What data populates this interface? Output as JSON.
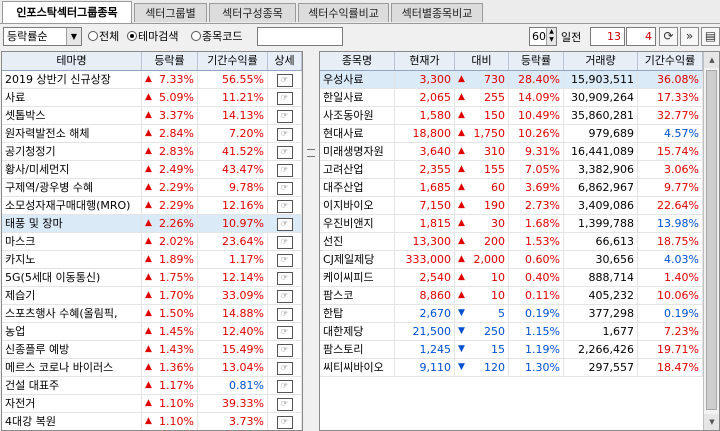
{
  "tabs": [
    "인포스탁섹터그룹종목",
    "섹터그룹별",
    "섹터구성종목",
    "섹터수익률비교",
    "섹터별종목비교"
  ],
  "toolbar": {
    "sort_select": "등락률순",
    "radio_all": "전체",
    "radio_theme": "테마검색",
    "radio_code": "종목코드",
    "code_value": "",
    "days_value": "60",
    "days_label": "일전",
    "num1": "13",
    "num2": "4",
    "icons": [
      "refresh-icon",
      "double-chevron-right-icon",
      "next-page-icon"
    ]
  },
  "colors": {
    "up": "#e00000",
    "down": "#0050d0",
    "highlight": "#dbeaf7",
    "header": "#e8eef6"
  },
  "left_table": {
    "headers": [
      "테마명",
      "등락률",
      "기간수익률",
      "상세"
    ],
    "detail_label": "☞",
    "rows": [
      {
        "name": "2019 상반기 신규상장",
        "change": "7.33%",
        "period": "56.55%",
        "dir": "up"
      },
      {
        "name": "사료",
        "change": "5.09%",
        "period": "11.21%",
        "dir": "up"
      },
      {
        "name": "셋톱박스",
        "change": "3.37%",
        "period": "14.13%",
        "dir": "up"
      },
      {
        "name": "원자력발전소 해체",
        "change": "2.84%",
        "period": "7.20%",
        "dir": "up"
      },
      {
        "name": "공기청정기",
        "change": "2.83%",
        "period": "41.52%",
        "dir": "up"
      },
      {
        "name": "황사/미세먼지",
        "change": "2.49%",
        "period": "43.47%",
        "dir": "up"
      },
      {
        "name": "구제역/광우병 수혜",
        "change": "2.29%",
        "period": "9.78%",
        "dir": "up"
      },
      {
        "name": "소모성자재구매대행(MRO)",
        "change": "2.29%",
        "period": "12.16%",
        "dir": "up"
      },
      {
        "name": "태풍 및 장마",
        "change": "2.26%",
        "period": "10.97%",
        "dir": "up",
        "hl": true
      },
      {
        "name": "마스크",
        "change": "2.02%",
        "period": "23.64%",
        "dir": "up"
      },
      {
        "name": "카지노",
        "change": "1.89%",
        "period": "1.17%",
        "dir": "up"
      },
      {
        "name": "5G(5세대 이동통신)",
        "change": "1.75%",
        "period": "12.14%",
        "dir": "up"
      },
      {
        "name": "제습기",
        "change": "1.70%",
        "period": "33.09%",
        "dir": "up"
      },
      {
        "name": "스포츠행사 수혜(올림픽,",
        "change": "1.50%",
        "period": "14.88%",
        "dir": "up"
      },
      {
        "name": "농업",
        "change": "1.45%",
        "period": "12.40%",
        "dir": "up"
      },
      {
        "name": "신종플루 예방",
        "change": "1.43%",
        "period": "15.49%",
        "dir": "up"
      },
      {
        "name": "메르스 코로나 바이러스",
        "change": "1.36%",
        "period": "13.04%",
        "dir": "up"
      },
      {
        "name": "건설 대표주",
        "change": "1.17%",
        "period": "0.81%",
        "dir": "up",
        "period_dir": "down"
      },
      {
        "name": "자전거",
        "change": "1.10%",
        "period": "39.33%",
        "dir": "up"
      },
      {
        "name": "4대강 복원",
        "change": "1.10%",
        "period": "3.73%",
        "dir": "up"
      }
    ]
  },
  "right_table": {
    "headers": [
      "종목명",
      "현재가",
      "대비",
      "등락률",
      "거래량",
      "기간수익률"
    ],
    "rows": [
      {
        "name": "우성사료",
        "price": "3,300",
        "diff": "730",
        "change": "28.40%",
        "volume": "15,903,511",
        "period": "36.08%",
        "dir": "up",
        "hl": true
      },
      {
        "name": "한일사료",
        "price": "2,065",
        "diff": "255",
        "change": "14.09%",
        "volume": "30,909,264",
        "period": "17.33%",
        "dir": "up"
      },
      {
        "name": "사조동아원",
        "price": "1,580",
        "diff": "150",
        "change": "10.49%",
        "volume": "35,860,281",
        "period": "32.77%",
        "dir": "up"
      },
      {
        "name": "현대사료",
        "price": "18,800",
        "diff": "1,750",
        "change": "10.26%",
        "volume": "979,689",
        "period": "4.57%",
        "dir": "up",
        "period_dir": "down"
      },
      {
        "name": "미래생명자원",
        "price": "3,640",
        "diff": "310",
        "change": "9.31%",
        "volume": "16,441,089",
        "period": "15.74%",
        "dir": "up"
      },
      {
        "name": "고려산업",
        "price": "2,355",
        "diff": "155",
        "change": "7.05%",
        "volume": "3,382,906",
        "period": "3.06%",
        "dir": "up"
      },
      {
        "name": "대주산업",
        "price": "1,685",
        "diff": "60",
        "change": "3.69%",
        "volume": "6,862,967",
        "period": "9.77%",
        "dir": "up"
      },
      {
        "name": "이지바이오",
        "price": "7,150",
        "diff": "190",
        "change": "2.73%",
        "volume": "3,409,086",
        "period": "22.64%",
        "dir": "up"
      },
      {
        "name": "우진비앤지",
        "price": "1,815",
        "diff": "30",
        "change": "1.68%",
        "volume": "1,399,788",
        "period": "13.98%",
        "dir": "up",
        "period_dir": "down"
      },
      {
        "name": "선진",
        "price": "13,300",
        "diff": "200",
        "change": "1.53%",
        "volume": "66,613",
        "period": "18.75%",
        "dir": "up"
      },
      {
        "name": "CJ제일제당",
        "price": "333,000",
        "diff": "2,000",
        "change": "0.60%",
        "volume": "30,656",
        "period": "4.03%",
        "dir": "up",
        "period_dir": "down"
      },
      {
        "name": "케이씨피드",
        "price": "2,540",
        "diff": "10",
        "change": "0.40%",
        "volume": "888,714",
        "period": "1.40%",
        "dir": "up"
      },
      {
        "name": "팜스코",
        "price": "8,860",
        "diff": "10",
        "change": "0.11%",
        "volume": "405,232",
        "period": "10.06%",
        "dir": "up"
      },
      {
        "name": "한탑",
        "price": "2,670",
        "diff": "5",
        "change": "0.19%",
        "volume": "377,298",
        "period": "0.19%",
        "dir": "down"
      },
      {
        "name": "대한제당",
        "price": "21,500",
        "diff": "250",
        "change": "1.15%",
        "volume": "1,677",
        "period": "7.23%",
        "dir": "down",
        "period_dir": "up"
      },
      {
        "name": "팜스토리",
        "price": "1,245",
        "diff": "15",
        "change": "1.19%",
        "volume": "2,266,426",
        "period": "19.71%",
        "dir": "down",
        "period_dir": "up"
      },
      {
        "name": "씨티씨바이오",
        "price": "9,110",
        "diff": "120",
        "change": "1.30%",
        "volume": "297,557",
        "period": "18.47%",
        "dir": "down",
        "period_dir": "up"
      }
    ]
  }
}
